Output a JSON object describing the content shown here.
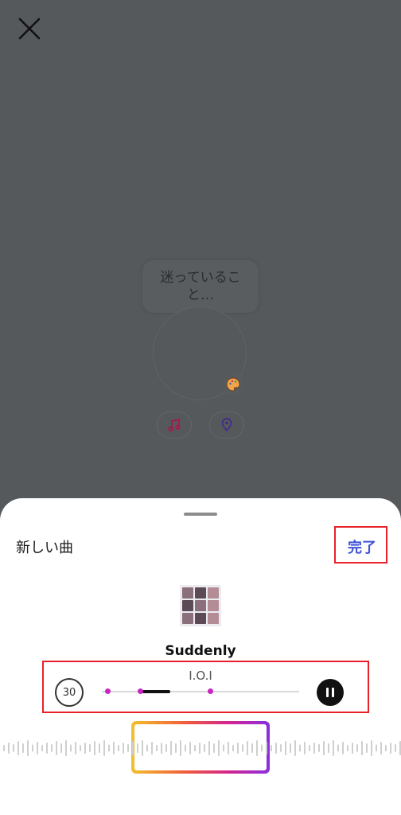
{
  "overlay": {
    "bubble_text": "迷っていること…"
  },
  "sheet": {
    "title": "新しい曲",
    "done_label": "完了"
  },
  "song": {
    "title": "Suddenly",
    "artist": "I.O.I",
    "duration": "30",
    "progress": 0.18
  },
  "colors": {
    "accent": "#3e52d6",
    "highlight": "#e8202a",
    "track_dot": "#c726c4"
  },
  "icons": {
    "close": "close-icon",
    "palette": "palette-icon",
    "music": "music-note-icon",
    "location": "location-pin-icon",
    "pause": "pause-icon"
  }
}
